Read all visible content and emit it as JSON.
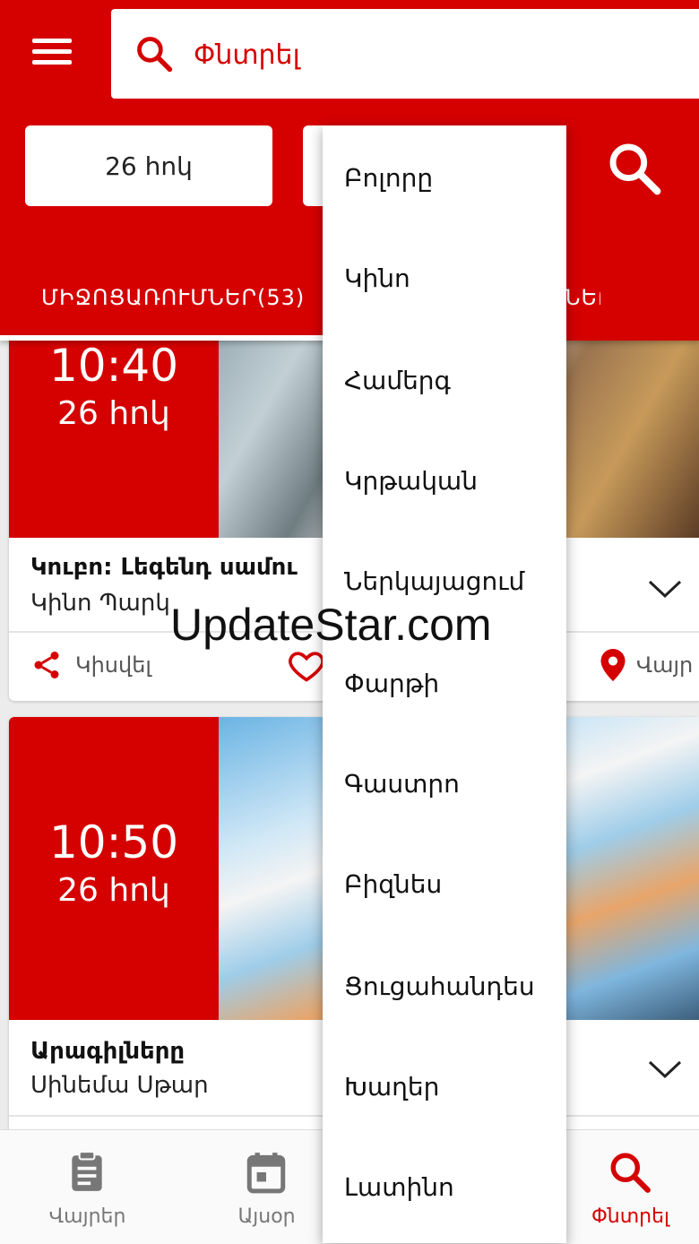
{
  "search": {
    "placeholder": "Փնտրել"
  },
  "filters": {
    "date": "26 հոկ"
  },
  "tabs": {
    "events": "ՄԻՋՈՑԱՌՈՒՄՆԵՐ(53)",
    "other_partial": "ՆԵՐ"
  },
  "cards": [
    {
      "time": "10:40",
      "day": "26 հոկ",
      "title": "Կուբո: Լեգենդ սամու",
      "venue": "Կինո Պարկ",
      "share": "Կիսվել",
      "location": "Վայր"
    },
    {
      "time": "10:50",
      "day": "26 հոկ",
      "title": "Արագիլները",
      "venue": "Սինեմա Սթար"
    }
  ],
  "dropdown": {
    "items": [
      "Բոլորը",
      "Կինո",
      "Համերգ",
      "Կրթական",
      "Ներկայացում",
      "Փարթի",
      "Գաստրո",
      "Բիզնես",
      "Ցուցահանդես",
      "Խաղեր",
      "Լատինո"
    ]
  },
  "bottom_nav": [
    {
      "label": "Վայրեր",
      "icon": "clipboard-icon"
    },
    {
      "label": "Այսօր",
      "icon": "calendar-icon"
    },
    {
      "label": "Փնտրել",
      "icon": "search-icon",
      "active": true
    }
  ],
  "watermark": "UpdateStar.com",
  "colors": {
    "accent": "#d50000"
  }
}
